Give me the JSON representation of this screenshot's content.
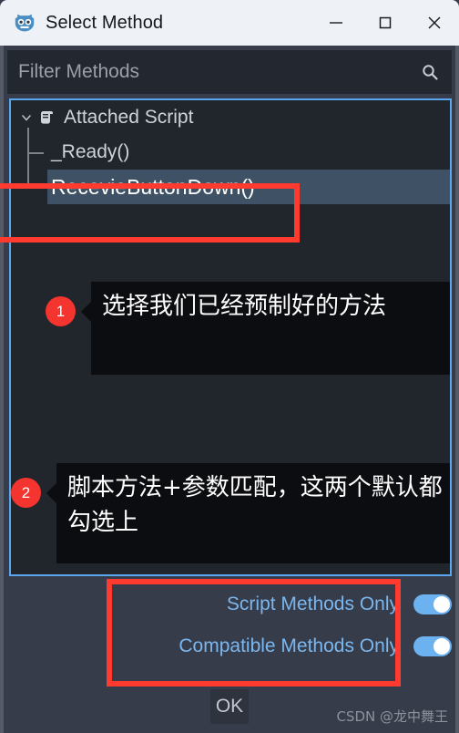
{
  "window": {
    "title": "Select Method",
    "app_icon": "godot-robot-icon",
    "controls": {
      "minimize": "minimize-icon",
      "maximize": "maximize-icon",
      "close": "close-icon"
    }
  },
  "filter": {
    "placeholder": "Filter Methods",
    "value": "",
    "icon": "search-icon"
  },
  "tree": {
    "root": {
      "label": "Attached Script",
      "expanded": true,
      "expand_icon": "chevron-down-icon",
      "type_icon": "script-icon"
    },
    "methods": [
      {
        "label": "_Ready()",
        "selected": false
      },
      {
        "label": "RecevieButtonDown()",
        "selected": true
      }
    ]
  },
  "annotations": [
    {
      "number": "1",
      "text": "选择我们已经预制好的方法"
    },
    {
      "number": "2",
      "text": "脚本方法+参数匹配，这两个默认都勾选上"
    }
  ],
  "options": [
    {
      "label": "Script Methods Only",
      "enabled": true
    },
    {
      "label": "Compatible Methods Only",
      "enabled": true
    }
  ],
  "buttons": {
    "ok": "OK"
  },
  "watermark": "CSDN @龙中舞王",
  "colors": {
    "titlebar_bg": "#eef2f7",
    "window_bg": "#363c4a",
    "panel_bg": "#21252c",
    "field_bg": "#232830",
    "focus_border": "#5aa7f0",
    "selection_bg": "#3f5265",
    "accent_blue": "#7bb7ef",
    "toggle_on": "#6cb2f0",
    "highlight_red": "#ff3b30",
    "badge_red": "#f3342f",
    "callout_bg": "#0c0d10"
  }
}
